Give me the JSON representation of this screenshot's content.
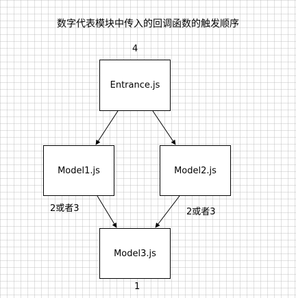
{
  "diagram": {
    "title": "数字代表模块中传入的回调函数的触发顺序",
    "nodes": {
      "entrance": {
        "label": "Entrance.js",
        "order": "4"
      },
      "model1": {
        "label": "Model1.js",
        "order": "2或者3"
      },
      "model2": {
        "label": "Model2.js",
        "order": "2或者3"
      },
      "model3": {
        "label": "Model3.js",
        "order": "1"
      }
    },
    "edges": [
      {
        "from": "entrance",
        "to": "model1"
      },
      {
        "from": "entrance",
        "to": "model2"
      },
      {
        "from": "model1",
        "to": "model3"
      },
      {
        "from": "model2",
        "to": "model3"
      }
    ]
  }
}
